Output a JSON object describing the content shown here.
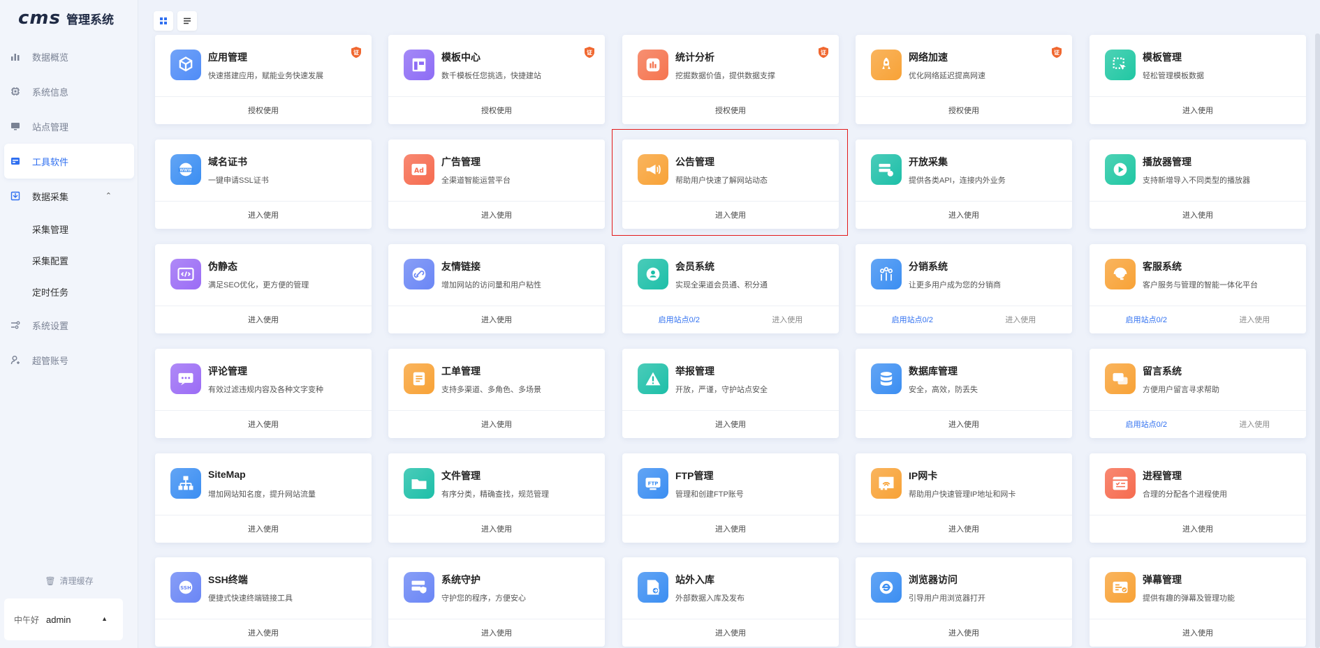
{
  "app": {
    "logo": "cms",
    "title": "管理系统"
  },
  "sidebar": {
    "items": [
      {
        "label": "数据概览",
        "icon": "bar-chart-icon"
      },
      {
        "label": "系统信息",
        "icon": "chip-icon"
      },
      {
        "label": "站点管理",
        "icon": "monitor-icon"
      },
      {
        "label": "工具软件",
        "icon": "toolbox-icon"
      },
      {
        "label": "数据采集",
        "icon": "collect-icon"
      }
    ],
    "submenu": [
      {
        "label": "采集管理"
      },
      {
        "label": "采集配置"
      },
      {
        "label": "定时任务"
      }
    ],
    "bottom_items": [
      {
        "label": "系统设置",
        "icon": "settings-icon"
      },
      {
        "label": "超管账号",
        "icon": "user-icon"
      }
    ],
    "clear_cache": "清理缓存",
    "greeting": "中午好",
    "username": "admin"
  },
  "cards": [
    {
      "title": "应用管理",
      "desc": "快速搭建应用，赋能业务快速发展",
      "action": "授权使用",
      "badge": "证",
      "color": "#4f8cf7",
      "icon": "cubes-icon"
    },
    {
      "title": "模板中心",
      "desc": "数千模板任您挑选，快捷建站",
      "action": "授权使用",
      "badge": "证",
      "color": "#8d6cf5",
      "icon": "layout-icon"
    },
    {
      "title": "统计分析",
      "desc": "挖掘数据价值，提供数据支撑",
      "action": "授权使用",
      "badge": "证",
      "color": "#f5744f",
      "icon": "stats-icon"
    },
    {
      "title": "网络加速",
      "desc": "优化网络延迟提高网速",
      "action": "授权使用",
      "badge": "证",
      "color": "#f8a236",
      "icon": "rocket-icon"
    },
    {
      "title": "模板管理",
      "desc": "轻松管理模板数据",
      "action": "进入使用",
      "color": "#20c7a3",
      "icon": "template-icon"
    },
    {
      "title": "域名证书",
      "desc": "一键申请SSL证书",
      "action": "进入使用",
      "color": "#3b8ef2",
      "icon": "www-icon"
    },
    {
      "title": "广告管理",
      "desc": "全渠道智能运营平台",
      "action": "进入使用",
      "color": "#f66b4f",
      "icon": "ad-icon"
    },
    {
      "title": "公告管理",
      "desc": "帮助用户快速了解网站动态",
      "action": "进入使用",
      "color": "#f8a236",
      "icon": "megaphone-icon"
    },
    {
      "title": "开放采集",
      "desc": "提供各类API，连接内外业务",
      "action": "进入使用",
      "color": "#1dbfa8",
      "icon": "server-icon"
    },
    {
      "title": "播放器管理",
      "desc": "支持新增导入不同类型的播放器",
      "action": "进入使用",
      "color": "#20c7a3",
      "icon": "play-icon"
    },
    {
      "title": "伪静态",
      "desc": "满足SEO优化，更方便的管理",
      "action": "进入使用",
      "color": "#9b6cf5",
      "icon": "code-icon"
    },
    {
      "title": "友情链接",
      "desc": "增加网站的访问量和用户粘性",
      "action": "进入使用",
      "color": "#6a86f5",
      "icon": "link-icon"
    },
    {
      "title": "会员系统",
      "desc": "实现全渠道会员通、积分通",
      "link": "启用站点0/2",
      "action": "进入使用",
      "color": "#1dbfa8",
      "icon": "member-icon"
    },
    {
      "title": "分销系统",
      "desc": "让更多用户成为您的分销商",
      "link": "启用站点0/2",
      "action": "进入使用",
      "color": "#3b8ef2",
      "icon": "distribution-icon"
    },
    {
      "title": "客服系统",
      "desc": "客户服务与管理的智能一体化平台",
      "link": "启用站点0/2",
      "action": "进入使用",
      "color": "#f8a236",
      "icon": "headset-icon"
    },
    {
      "title": "评论管理",
      "desc": "有效过滤违规内容及各种文字变种",
      "action": "进入使用",
      "color": "#9b6cf5",
      "icon": "comment-icon"
    },
    {
      "title": "工单管理",
      "desc": "支持多渠道、多角色、多场景",
      "action": "进入使用",
      "color": "#f8a236",
      "icon": "ticket-icon"
    },
    {
      "title": "举报管理",
      "desc": "开放，严谨，守护站点安全",
      "action": "进入使用",
      "color": "#1dbfa8",
      "icon": "warning-icon"
    },
    {
      "title": "数据库管理",
      "desc": "安全，高效，防丢失",
      "action": "进入使用",
      "color": "#3b8ef2",
      "icon": "database-icon"
    },
    {
      "title": "留言系统",
      "desc": "方便用户留言寻求帮助",
      "link": "启用站点0/2",
      "action": "进入使用",
      "color": "#f8a236",
      "icon": "message-icon"
    },
    {
      "title": "SiteMap",
      "desc": "增加网站知名度，提升网站流量",
      "action": "进入使用",
      "color": "#3b8ef2",
      "icon": "sitemap-icon"
    },
    {
      "title": "文件管理",
      "desc": "有序分类，精确查找，规范管理",
      "action": "进入使用",
      "color": "#1dbfa8",
      "icon": "folder-icon"
    },
    {
      "title": "FTP管理",
      "desc": "管理和创建FTP账号",
      "action": "进入使用",
      "color": "#3b8ef2",
      "icon": "ftp-icon"
    },
    {
      "title": "IP网卡",
      "desc": "帮助用户快速管理IP地址和网卡",
      "action": "进入使用",
      "color": "#f8a236",
      "icon": "network-card-icon"
    },
    {
      "title": "进程管理",
      "desc": "合理的分配各个进程使用",
      "action": "进入使用",
      "color": "#f66b4f",
      "icon": "process-icon"
    },
    {
      "title": "SSH终端",
      "desc": "便捷式快速终端链接工具",
      "action": "进入使用",
      "color": "#6a86f5",
      "icon": "ssh-icon"
    },
    {
      "title": "系统守护",
      "desc": "守护您的程序，方便安心",
      "action": "进入使用",
      "color": "#6a86f5",
      "icon": "shield-server-icon"
    },
    {
      "title": "站外入库",
      "desc": "外部数据入库及发布",
      "action": "进入使用",
      "color": "#3b8ef2",
      "icon": "import-icon"
    },
    {
      "title": "浏览器访问",
      "desc": "引导用户用浏览器打开",
      "action": "进入使用",
      "color": "#3b8ef2",
      "icon": "browser-icon"
    },
    {
      "title": "弹幕管理",
      "desc": "提供有趣的弹幕及管理功能",
      "action": "进入使用",
      "color": "#f8a236",
      "icon": "danmaku-icon"
    }
  ]
}
